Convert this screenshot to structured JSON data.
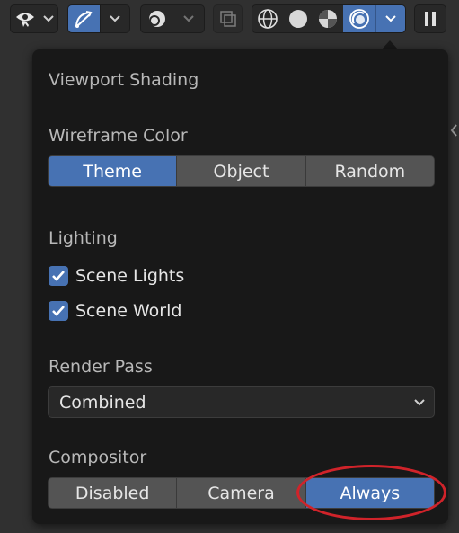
{
  "toolbar": {
    "groups": [
      {
        "icons": [
          "eye-icon"
        ],
        "has_dropdown": true
      },
      {
        "icons": [
          "gizmo-icon"
        ],
        "has_dropdown": true
      },
      {
        "icons": [
          "overlay-icon"
        ],
        "has_dropdown": true
      },
      {
        "icons": [
          "xray-icon"
        ],
        "has_dropdown": false
      },
      {
        "icons": [
          "wireframe-shading-icon",
          "solid-shading-icon",
          "material-shading-icon",
          "rendered-shading-icon"
        ],
        "has_dropdown": true
      }
    ],
    "active_shading": "rendered",
    "accent_color": "#4772b3"
  },
  "popover": {
    "title": "Viewport Shading",
    "wireframe_color": {
      "label": "Wireframe Color",
      "options": [
        "Theme",
        "Object",
        "Random"
      ],
      "selected": "Theme"
    },
    "lighting": {
      "label": "Lighting",
      "scene_lights": {
        "label": "Scene Lights",
        "checked": true
      },
      "scene_world": {
        "label": "Scene World",
        "checked": true
      }
    },
    "render_pass": {
      "label": "Render Pass",
      "value": "Combined"
    },
    "compositor": {
      "label": "Compositor",
      "options": [
        "Disabled",
        "Camera",
        "Always"
      ],
      "selected": "Always"
    }
  },
  "annotation": {
    "color": "#d0232a",
    "target": "Always"
  }
}
